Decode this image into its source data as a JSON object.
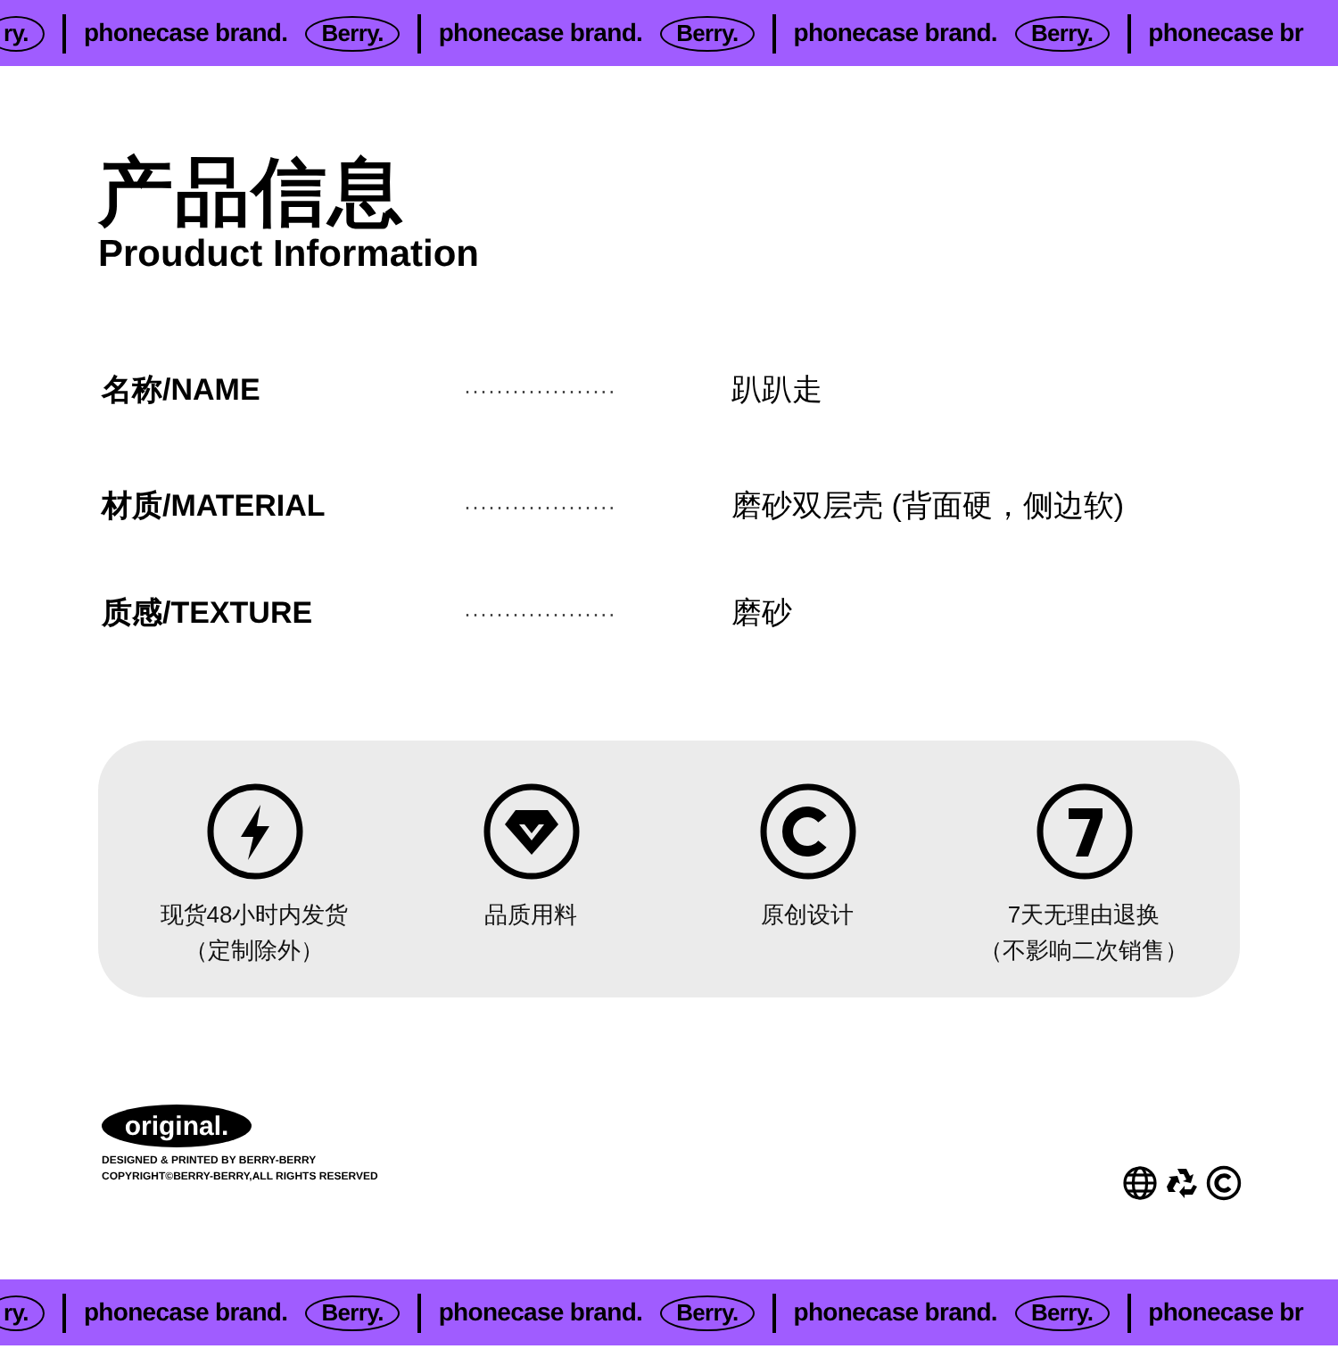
{
  "top_banner": [
    {
      "kind": "badge",
      "text": "ry."
    },
    {
      "kind": "divider"
    },
    {
      "kind": "text",
      "text": "phonecase brand."
    },
    {
      "kind": "badge",
      "text": "Berry."
    },
    {
      "kind": "divider"
    },
    {
      "kind": "text",
      "text": "phonecase brand."
    },
    {
      "kind": "badge",
      "text": "Berry."
    },
    {
      "kind": "divider"
    },
    {
      "kind": "text",
      "text": "phonecase brand."
    },
    {
      "kind": "badge",
      "text": "Berry."
    },
    {
      "kind": "divider"
    },
    {
      "kind": "text",
      "text": "phonecase br"
    }
  ],
  "heading": {
    "title": "产品信息",
    "subtitle": "Prouduct Information"
  },
  "specs": [
    {
      "label": "名称/NAME",
      "dots": "···················",
      "value": "趴趴走"
    },
    {
      "label": "材质/MATERIAL",
      "dots": "···················",
      "value": "磨砂双层壳 (背面硬，侧边软)"
    },
    {
      "label": "质感/TEXTURE",
      "dots": "···················",
      "value": "磨砂"
    }
  ],
  "features": [
    {
      "kind": "bolt",
      "lines": [
        "现货48小时内发货",
        "（定制除外）"
      ]
    },
    {
      "kind": "diamond",
      "lines": [
        "品质用料"
      ]
    },
    {
      "kind": "copyright",
      "lines": [
        "原创设计"
      ]
    },
    {
      "kind": "seven",
      "lines": [
        "7天无理由退换",
        "（不影响二次销售）"
      ]
    }
  ],
  "footer": {
    "logo": "original.",
    "lines": [
      "DESIGNED & PRINTED BY BERRY-BERRY",
      "COPYRIGHT©BERRY-BERRY,ALL RIGHTS RESERVED"
    ]
  },
  "bottom_banner": [
    {
      "kind": "badge",
      "text": "ry."
    },
    {
      "kind": "divider"
    },
    {
      "kind": "text",
      "text": "phonecase brand."
    },
    {
      "kind": "badge",
      "text": "Berry."
    },
    {
      "kind": "divider"
    },
    {
      "kind": "text",
      "text": "phonecase brand."
    },
    {
      "kind": "badge",
      "text": "Berry."
    },
    {
      "kind": "divider"
    },
    {
      "kind": "text",
      "text": "phonecase brand."
    },
    {
      "kind": "badge",
      "text": "Berry."
    },
    {
      "kind": "divider"
    },
    {
      "kind": "text",
      "text": "phonecase br"
    }
  ]
}
